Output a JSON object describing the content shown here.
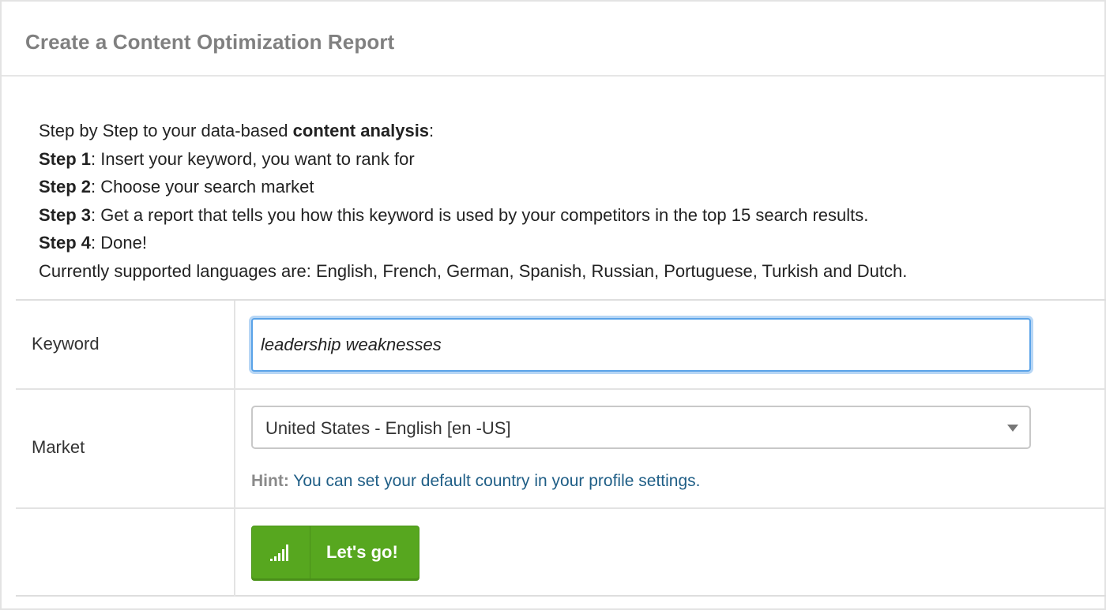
{
  "header": {
    "title": "Create a Content Optimization Report"
  },
  "intro": {
    "line1_prefix": "Step by Step to your data-based ",
    "line1_bold": "content analysis",
    "line1_suffix": ":",
    "steps": [
      {
        "label": "Step 1",
        "text": ": Insert your keyword, you want to rank for"
      },
      {
        "label": "Step 2",
        "text": ": Choose your search market"
      },
      {
        "label": "Step 3",
        "text": ": Get a report that tells you how this keyword is used by your competitors in the top 15 search results."
      },
      {
        "label": "Step 4",
        "text": ": Done!"
      }
    ],
    "languages": "Currently supported languages are: English, French, German, Spanish, Russian, Portuguese, Turkish and Dutch."
  },
  "form": {
    "keyword": {
      "label": "Keyword",
      "value": "leadership weaknesses"
    },
    "market": {
      "label": "Market",
      "selected": "United States - English [en -US]",
      "hint_label": "Hint:",
      "hint_text": " You can set your default country in your profile settings."
    },
    "submit": {
      "label": "Let's go!",
      "icon": "signal-bars-icon"
    }
  },
  "colors": {
    "button_green": "#57a71f",
    "focus_blue": "#5aa3e8",
    "hint_link": "#1f5e86",
    "title_gray": "#808080"
  }
}
